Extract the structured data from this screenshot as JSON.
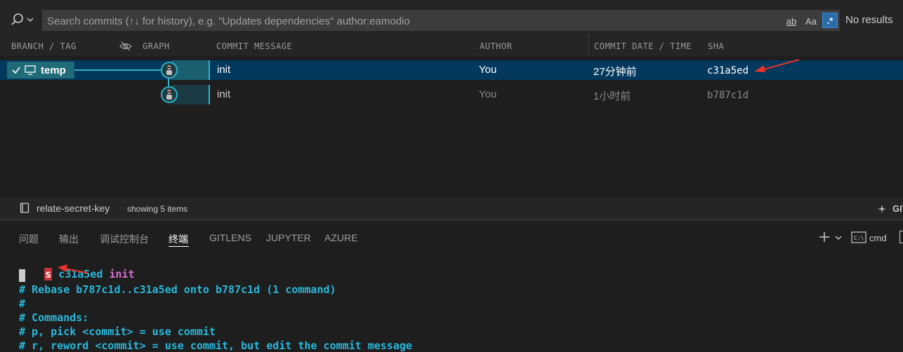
{
  "search": {
    "placeholder": "Search commits (↑↓ for history), e.g. \"Updates dependencies\" author:eamodio",
    "opt_word": "ab",
    "opt_case": "Aa",
    "opt_regex": ".*",
    "no_results": "No results"
  },
  "columns": {
    "branch": "BRANCH / TAG",
    "graph": "GRAPH",
    "message": "COMMIT MESSAGE",
    "author": "AUTHOR",
    "date": "COMMIT DATE / TIME",
    "sha": "SHA"
  },
  "commits": [
    {
      "branch": "temp",
      "message": "init",
      "author": "You",
      "date": "27分钟前",
      "sha": "c31a5ed",
      "selected": true
    },
    {
      "branch": "",
      "message": "init",
      "author": "You",
      "date": "1小时前",
      "sha": "b787c1d",
      "selected": false
    }
  ],
  "status": {
    "repo": "relate-secret-key",
    "showing": "showing 5 items",
    "right": "GIT"
  },
  "panel": {
    "tabs": [
      "问题",
      "输出",
      "调试控制台",
      "终端",
      "GITLENS",
      "JUPYTER",
      "AZURE"
    ],
    "active_tab": "终端",
    "shell": "cmd"
  },
  "terminal": {
    "cmd_letter": "s",
    "line1_sha": "c31a5ed",
    "line1_msg": "init",
    "lines": [
      "# Rebase b787c1d..c31a5ed onto b787c1d (1 command)",
      "#",
      "# Commands:",
      "# p, pick <commit> = use commit",
      "# r, reword <commit> = use commit, but edit the commit message"
    ]
  },
  "colors": {
    "selected_row": "#04395e",
    "graph_accent": "#2fb2c6",
    "terminal_cyan": "#29b8db",
    "terminal_magenta": "#d670d6",
    "arrow_red": "#e8312a"
  }
}
